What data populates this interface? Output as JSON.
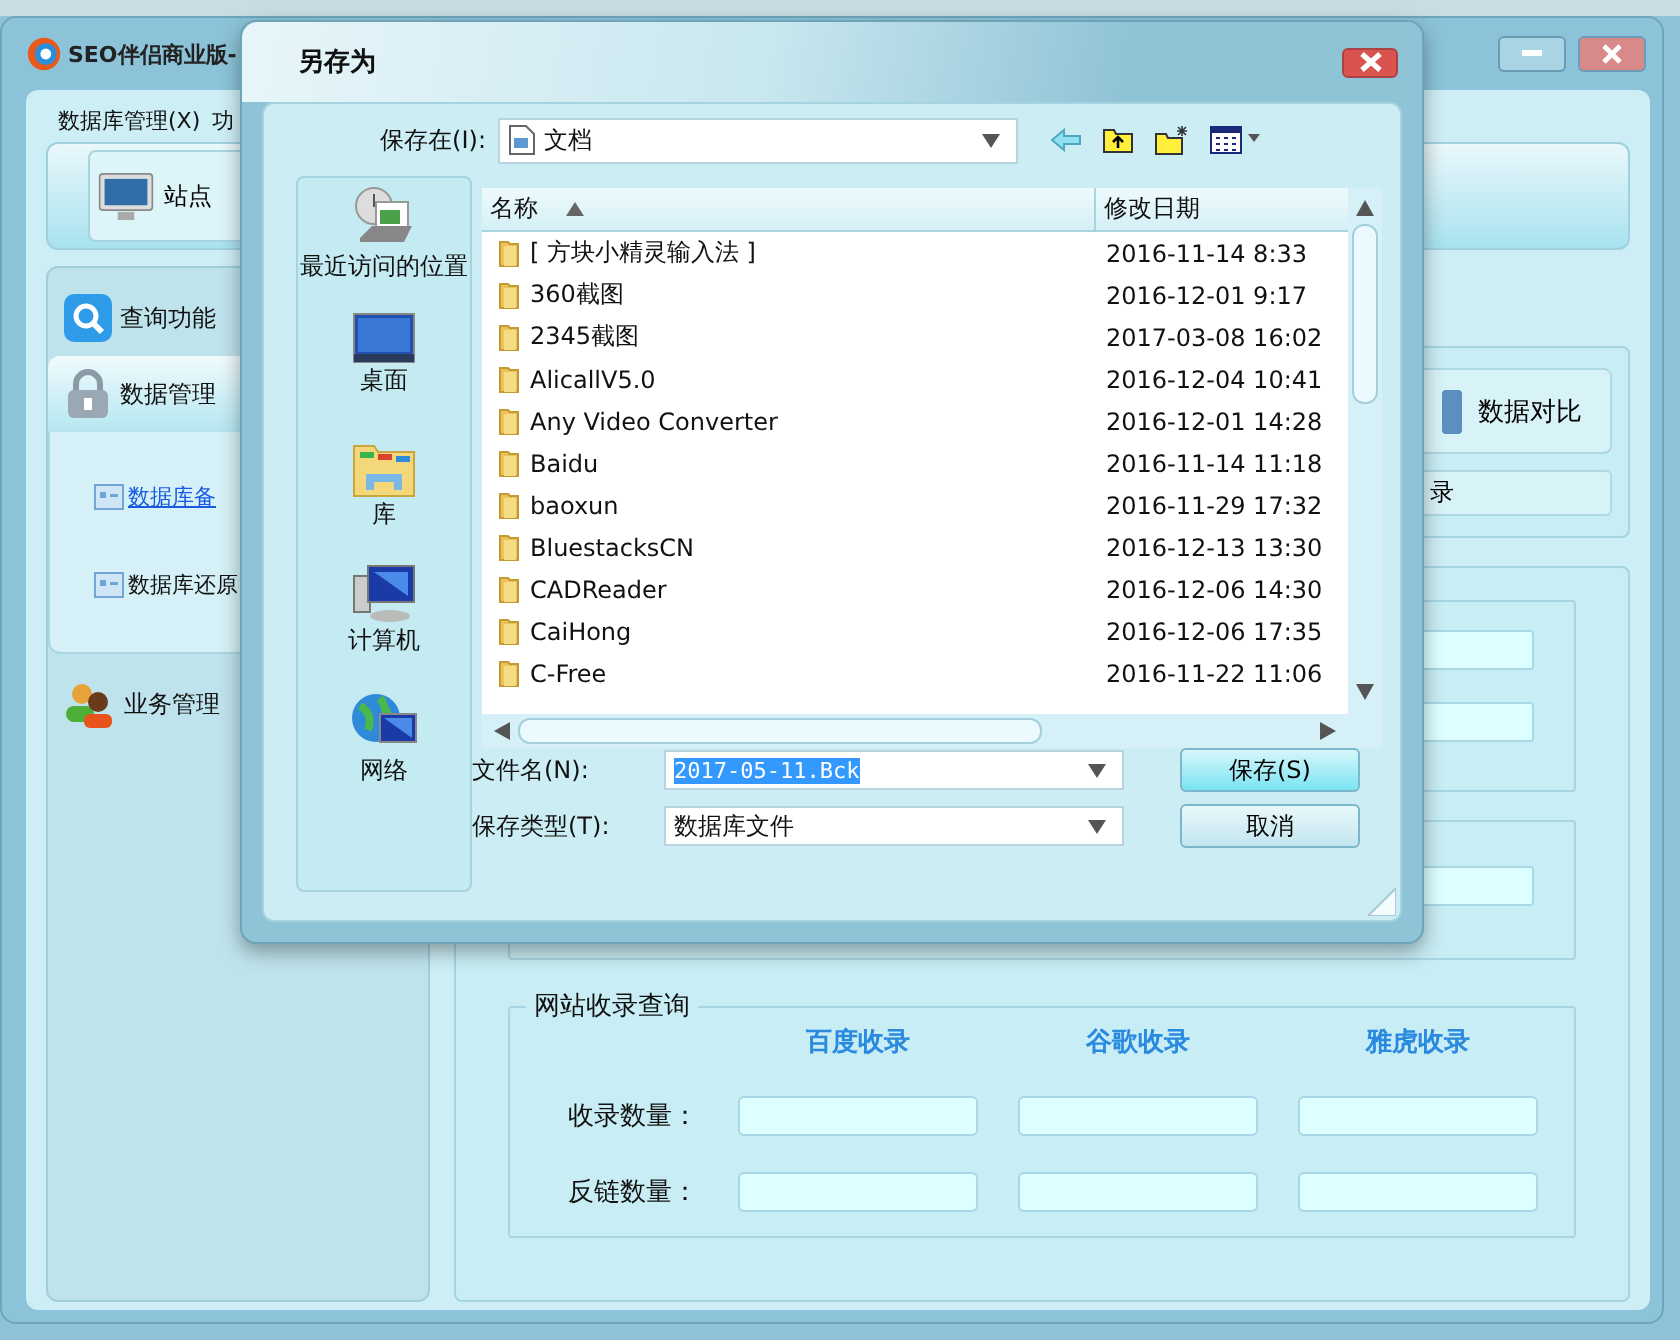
{
  "app_window": {
    "title": "SEO伴侣商业版-",
    "menu": [
      "数据库管理(X)",
      "功"
    ],
    "toolbar_button": "站点"
  },
  "sidebar": {
    "items": [
      {
        "label": "查询功能",
        "expanded": false
      },
      {
        "label": "数据管理",
        "expanded": true,
        "children": [
          {
            "label": "数据库备",
            "selected": true
          },
          {
            "label": "数据库还原",
            "selected": false
          }
        ]
      },
      {
        "label": "业务管理",
        "expanded": false
      }
    ]
  },
  "main": {
    "top_buttons": [
      "数据对比",
      "录"
    ],
    "index_group": {
      "title": "网站收录查询",
      "columns": [
        "百度收录",
        "谷歌收录",
        "雅虎收录"
      ],
      "rows": [
        "收录数量：",
        "反链数量："
      ]
    }
  },
  "dialog": {
    "title": "另存为",
    "save_in_label": "保存在(I):",
    "save_in_value": "文档",
    "places": [
      "最近访问的位置",
      "桌面",
      "库",
      "计算机",
      "网络"
    ],
    "columns": [
      "名称",
      "修改日期"
    ],
    "files": [
      {
        "name": "[ 方块小精灵输入法 ]",
        "date": "2016-11-14 8:33"
      },
      {
        "name": "360截图",
        "date": "2016-12-01 9:17"
      },
      {
        "name": "2345截图",
        "date": "2017-03-08 16:02"
      },
      {
        "name": "AlicallV5.0",
        "date": "2016-12-04 10:41"
      },
      {
        "name": "Any Video Converter",
        "date": "2016-12-01 14:28"
      },
      {
        "name": "Baidu",
        "date": "2016-11-14 11:18"
      },
      {
        "name": "baoxun",
        "date": "2016-11-29 17:32"
      },
      {
        "name": "BluestacksCN",
        "date": "2016-12-13 13:30"
      },
      {
        "name": "CADReader",
        "date": "2016-12-06 14:30"
      },
      {
        "name": "CaiHong",
        "date": "2016-12-06 17:35"
      },
      {
        "name": "C-Free",
        "date": "2016-11-22 11:06"
      }
    ],
    "file_name_label": "文件名(N):",
    "file_name_value": "2017-05-11.Bck",
    "file_type_label": "保存类型(T):",
    "file_type_value": "数据库文件",
    "buttons": [
      "保存(S)",
      "取消"
    ]
  }
}
